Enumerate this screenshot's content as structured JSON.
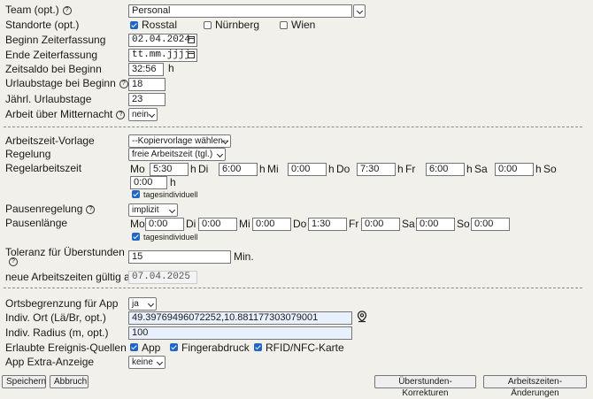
{
  "team": {
    "label": "Team (opt.)",
    "value": "Personal"
  },
  "standorte": {
    "label": "Standorte (opt.)",
    "options": [
      {
        "label": "Rosstal",
        "checked": true
      },
      {
        "label": "Nürnberg",
        "checked": false
      },
      {
        "label": "Wien",
        "checked": false
      }
    ]
  },
  "beginn": {
    "label": "Beginn Zeiterfassung",
    "value": "02.04.2024"
  },
  "ende": {
    "label": "Ende Zeiterfassung",
    "value": "tt.mm.jjjj"
  },
  "saldo": {
    "label": "Zeitsaldo bei Beginn",
    "value": "32:56",
    "unit": "h"
  },
  "urlaub_beginn": {
    "label": "Urlaubstage bei Beginn",
    "value": "18"
  },
  "urlaub_jahr": {
    "label": "Jährl. Urlaubstage",
    "value": "23"
  },
  "mitternacht": {
    "label": "Arbeit über Mitternacht",
    "value": "nein"
  },
  "vorlage": {
    "label": "Arbeitszeit-Vorlage",
    "value": "--Kopiervorlage wählen--"
  },
  "regelung": {
    "label": "Regelung",
    "value": "freie Arbeitszeit (tgl.)"
  },
  "regelarbeitszeit": {
    "label": "Regelarbeitszeit",
    "unit": "h",
    "days": [
      {
        "day": "Mo",
        "value": "5:30"
      },
      {
        "day": "Di",
        "value": "6:00"
      },
      {
        "day": "Mi",
        "value": "0:00"
      },
      {
        "day": "Do",
        "value": "7:30"
      },
      {
        "day": "Fr",
        "value": "6:00"
      },
      {
        "day": "Sa",
        "value": "0:00"
      },
      {
        "day": "So",
        "value": "0:00"
      }
    ],
    "tagesindividuell": "tagesindividuell"
  },
  "pausenregelung": {
    "label": "Pausenregelung",
    "value": "implizit"
  },
  "pausenlaenge": {
    "label": "Pausenlänge",
    "days": [
      {
        "day": "Mo",
        "value": "0:00"
      },
      {
        "day": "Di",
        "value": "0:00"
      },
      {
        "day": "Mi",
        "value": "0:00"
      },
      {
        "day": "Do",
        "value": "1:30"
      },
      {
        "day": "Fr",
        "value": "0:00"
      },
      {
        "day": "Sa",
        "value": "0:00"
      },
      {
        "day": "So",
        "value": "0:00"
      }
    ],
    "tagesindividuell": "tagesindividuell"
  },
  "toleranz": {
    "label": "Toleranz für Überstunden",
    "value": "15",
    "unit": "Min."
  },
  "gueltig": {
    "label": "neue Arbeitszeiten gültig ab",
    "value": "07.04.2025"
  },
  "ortsbegrenzung": {
    "label": "Ortsbegrenzung für App",
    "value": "ja"
  },
  "ort": {
    "label": "Indiv. Ort (Lä/Br, opt.)",
    "value": "49.39769496072252,10.881177303079001"
  },
  "radius": {
    "label": "Indiv. Radius (m, opt.)",
    "value": "100"
  },
  "quellen": {
    "label": "Erlaubte Ereignis-Quellen",
    "options": [
      {
        "label": "App",
        "checked": true
      },
      {
        "label": "Fingerabdruck",
        "checked": true
      },
      {
        "label": "RFID/NFC-Karte",
        "checked": true
      }
    ]
  },
  "extra": {
    "label": "App Extra-Anzeige",
    "value": "keine"
  },
  "buttons": {
    "speichern": "Speichern",
    "abbruch": "Abbruch",
    "ueberstunden": "Überstunden-Korrekturen",
    "arbeitszeiten": "Arbeitszeiten-Änderungen"
  },
  "colors": {
    "background": "#f2f0ea",
    "checkbox": "#1f67c7",
    "highlight_input": "#e8f0fe"
  }
}
